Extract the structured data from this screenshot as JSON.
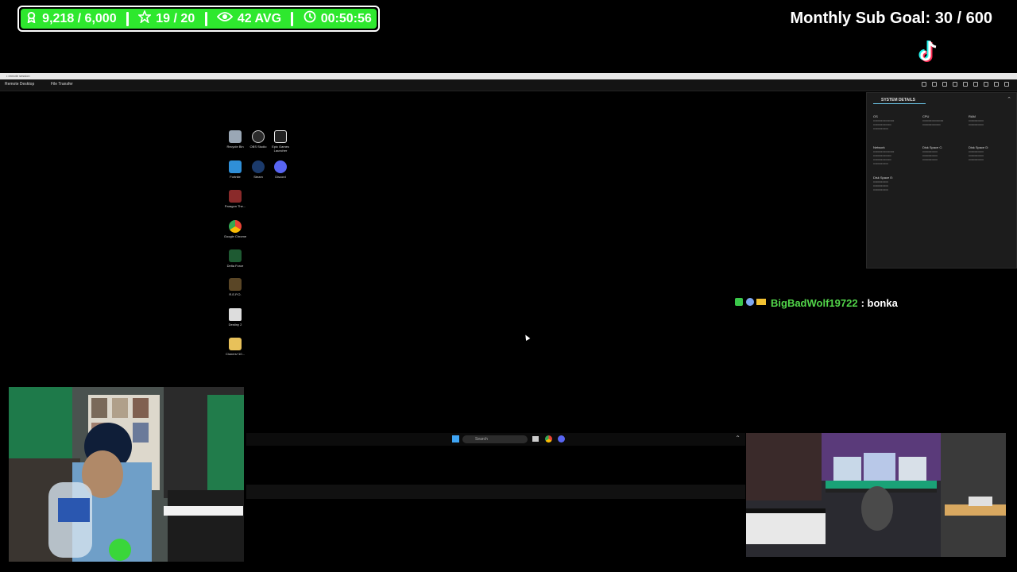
{
  "stats": {
    "followers": "9,218 / 6,000",
    "subs": "19 / 20",
    "viewers": "42 AVG",
    "uptime": "00:50:56"
  },
  "sub_goal": "Monthly Sub Goal:  30 / 600",
  "remote": {
    "tabs": [
      "Remote Desktop",
      "File Transfer"
    ]
  },
  "desktop_icons": [
    {
      "name": "recycle-bin-icon",
      "label": "Recycle Bin"
    },
    {
      "name": "obs-studio-icon",
      "label": "OBS Studio"
    },
    {
      "name": "epic-games-icon",
      "label": "Epic Games Launcher"
    },
    {
      "name": "fortnite-icon",
      "label": "Fortnite"
    },
    {
      "name": "steam-icon",
      "label": "Steam"
    },
    {
      "name": "discord-icon",
      "label": "Discord"
    },
    {
      "name": "paragon-icon",
      "label": "Paragon The..."
    },
    {
      "name": "chrome-icon",
      "label": "Google Chrome"
    },
    {
      "name": "delta-force-icon",
      "label": "Delta Force"
    },
    {
      "name": "repo-icon",
      "label": "R.E.P.O."
    },
    {
      "name": "destiny-icon",
      "label": "Destiny 2"
    },
    {
      "name": "folder-icon",
      "label": "Cloners+10..."
    }
  ],
  "system_details": {
    "title": "SYSTEM DETAILS",
    "os": "OS",
    "cpu": "CPU",
    "ram": "RAM",
    "network": "Network",
    "disk_c": "Disk Space C:",
    "disk_d": "Disk Space D:",
    "disk_e": "Disk Space E:"
  },
  "chat": {
    "user": "BigBadWolf19722",
    "message": ": bonka"
  },
  "taskbar": {
    "search": "Search"
  },
  "colors": {
    "stats_green": "#2ee82e",
    "chat_user": "#52d64a",
    "panel_accent": "#6bc5e8"
  }
}
